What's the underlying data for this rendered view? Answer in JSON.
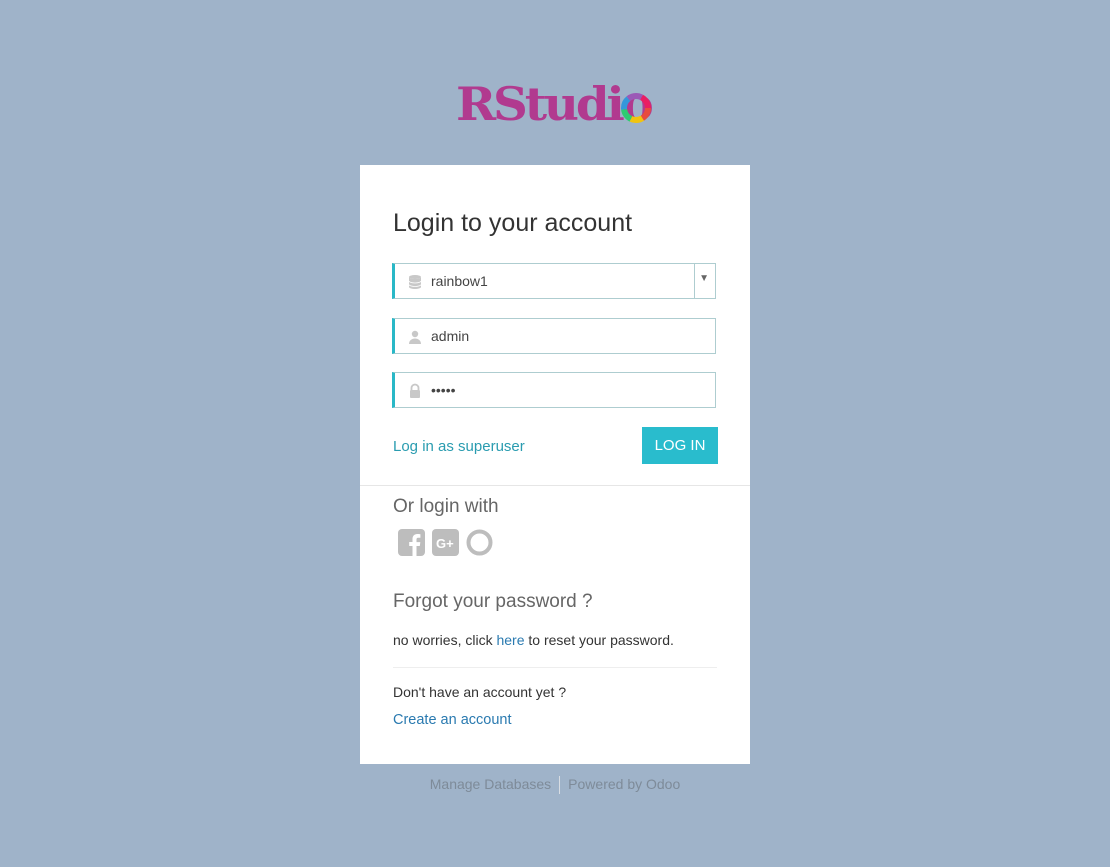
{
  "logo": {
    "text": "RStudio"
  },
  "login": {
    "title": "Login to your account",
    "database": {
      "value": "rainbow1",
      "icon": "database-icon"
    },
    "username": {
      "value": "admin",
      "icon": "user-icon"
    },
    "password": {
      "value": "•••••",
      "icon": "lock-icon"
    },
    "superuser_link": "Log in as superuser",
    "login_button": "LOG IN"
  },
  "social": {
    "heading": "Or login with",
    "providers": [
      "facebook-icon",
      "google-plus-icon",
      "odoo-icon"
    ]
  },
  "forgot": {
    "heading": "Forgot your password ?",
    "text_before": "no worries, click ",
    "link": "here",
    "text_after": " to reset your password."
  },
  "signup": {
    "question": "Don't have an account yet ?",
    "link": "Create an account"
  },
  "footer": {
    "manage": "Manage Databases",
    "powered": "Powered by Odoo"
  },
  "colors": {
    "background": "#9fb3c9",
    "accent": "#29bccd",
    "brand": "#b13a8f",
    "link": "#2a9cb0"
  }
}
